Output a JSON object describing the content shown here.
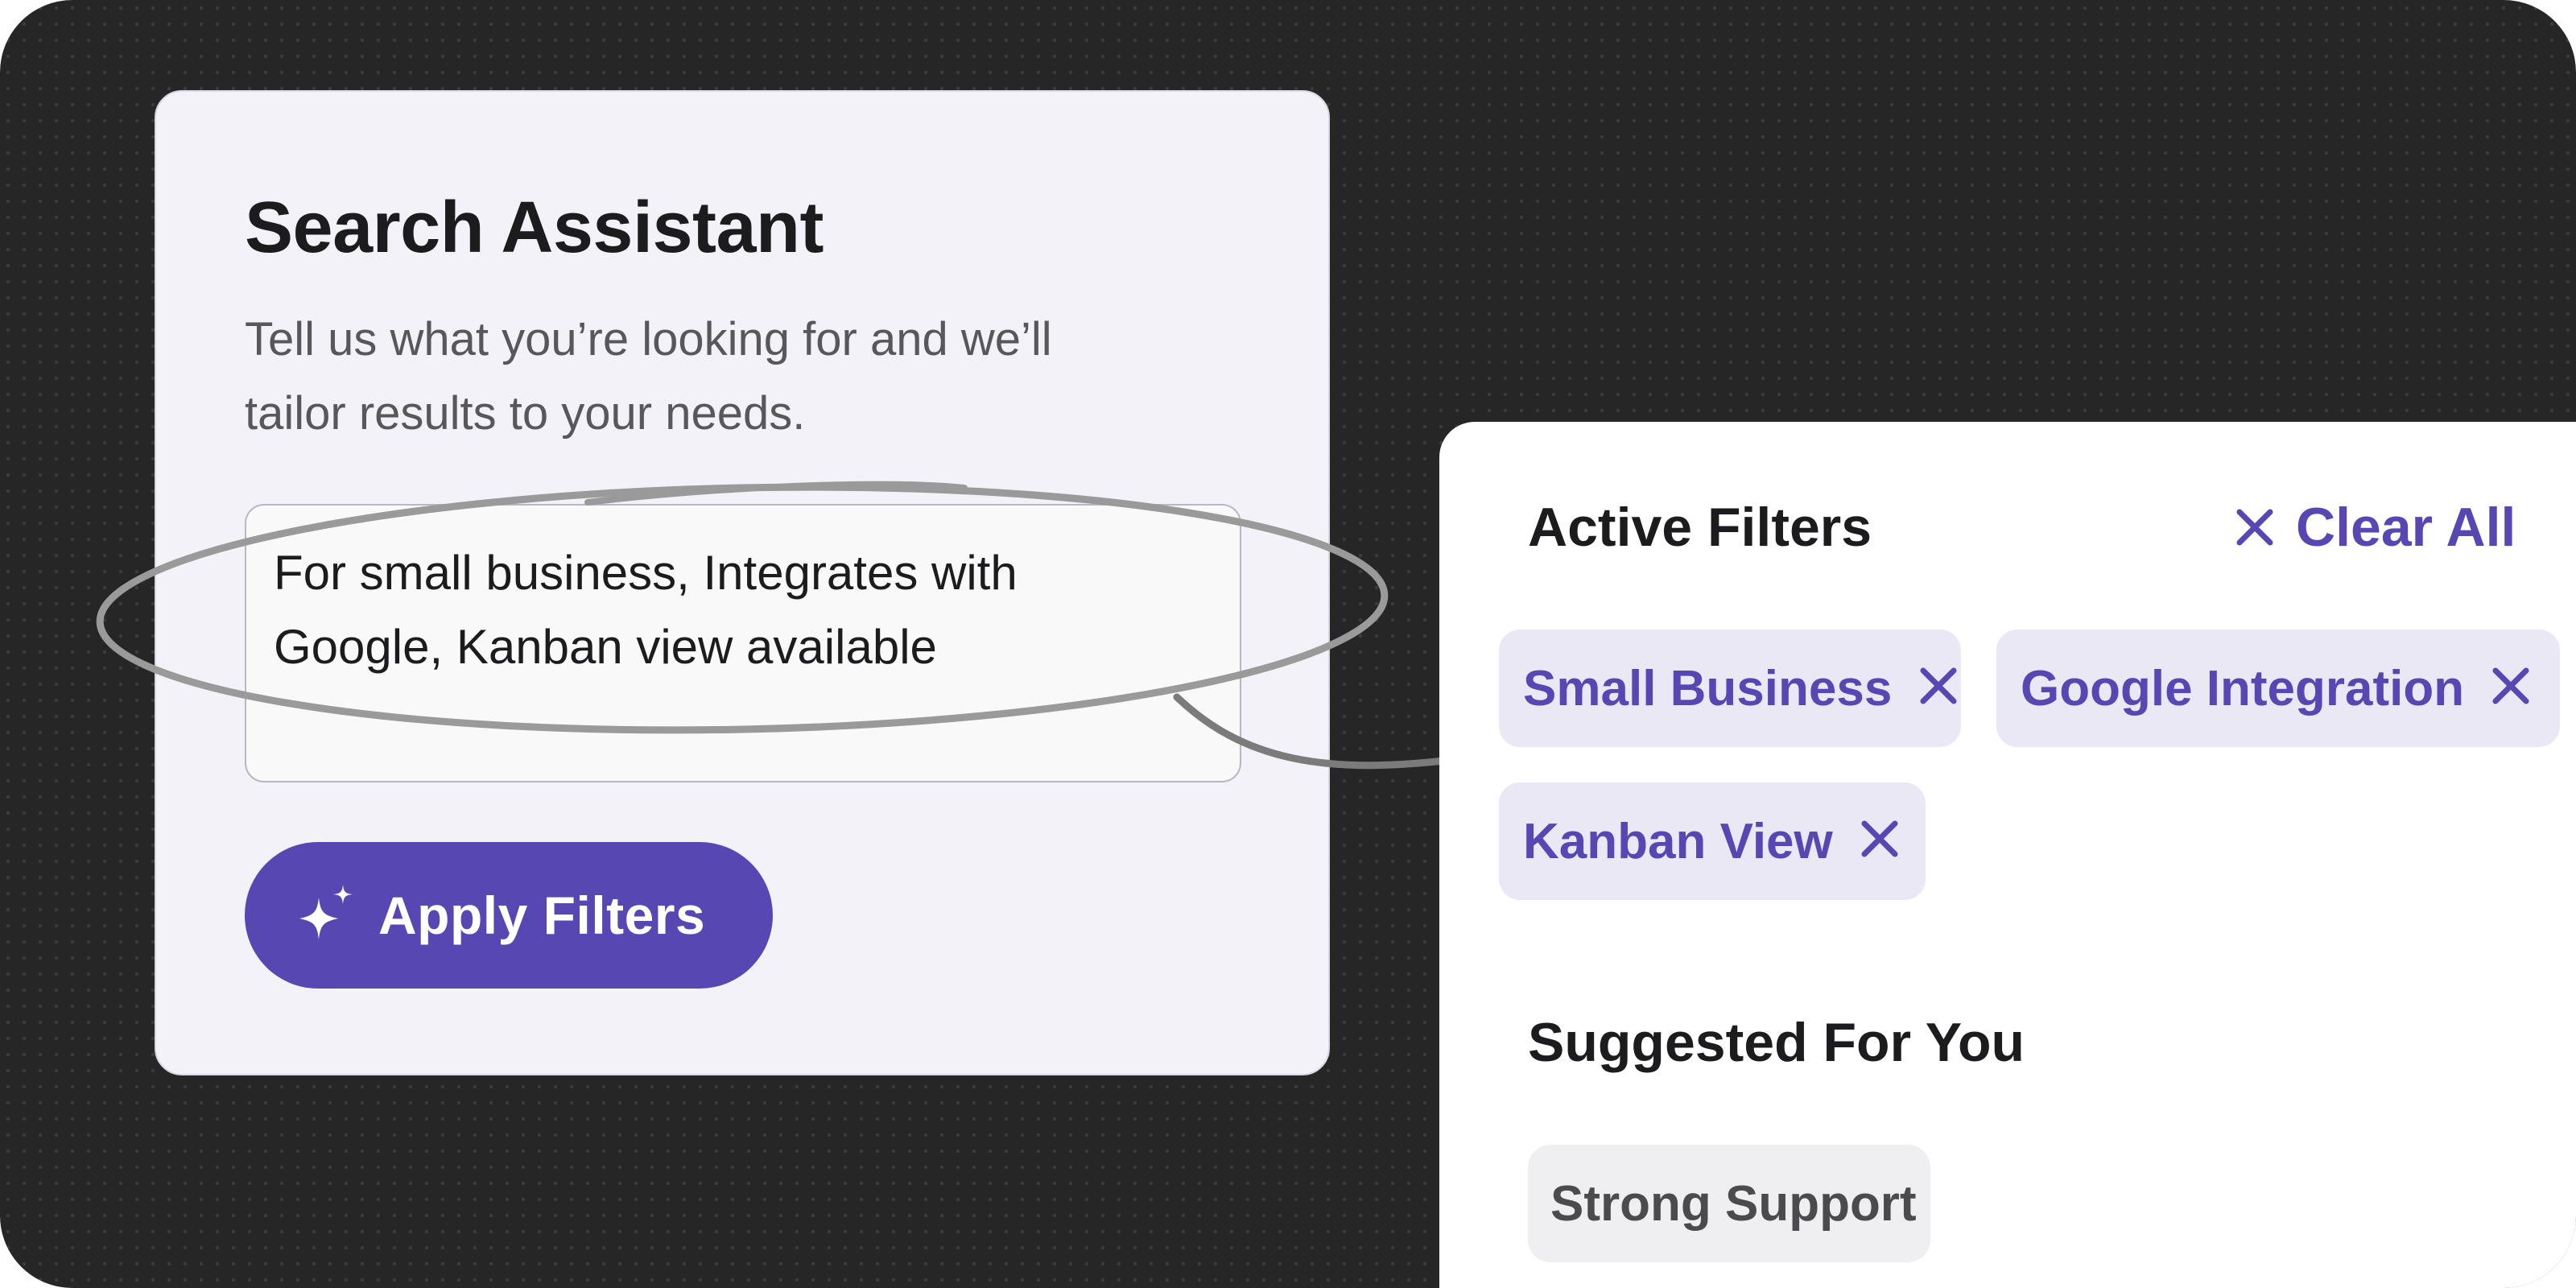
{
  "search_assistant": {
    "title": "Search Assistant",
    "subtitle_line1": "Tell us what you’re looking for and we’ll",
    "subtitle_line2": "tailor results to your needs.",
    "query_line1": "For small business, Integrates with",
    "query_line2": "Google, Kanban view available",
    "apply_button_label": "Apply Filters",
    "apply_button_icon": "sparkle-icon"
  },
  "active_filters": {
    "title": "Active Filters",
    "clear_all_label": "Clear All",
    "clear_all_icon": "close-icon",
    "chips": [
      {
        "label": "Small Business",
        "icon": "close-icon"
      },
      {
        "label": "Google Integration",
        "icon": "close-icon"
      },
      {
        "label": "Kanban View",
        "icon": "close-icon"
      }
    ]
  },
  "suggested": {
    "title": "Suggested For You",
    "chips": [
      {
        "label": "Strong Support"
      }
    ]
  },
  "colors": {
    "accent": "#5747b2",
    "chip_background": "#ebe8f6",
    "canvas_background": "#262626",
    "card_background": "#f3f2f9",
    "annotation_stroke": "#9a9a9a"
  }
}
